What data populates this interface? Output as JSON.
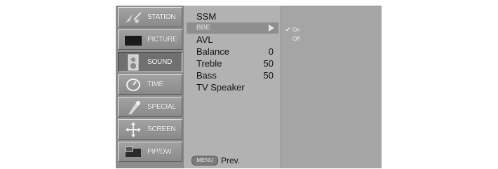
{
  "sidebar": {
    "items": [
      {
        "label": "STATION",
        "icon": "station-icon"
      },
      {
        "label": "PICTURE",
        "icon": "picture-icon"
      },
      {
        "label": "SOUND",
        "icon": "speaker-icon",
        "active": true
      },
      {
        "label": "TIME",
        "icon": "clock-icon"
      },
      {
        "label": "SPECIAL",
        "icon": "special-icon"
      },
      {
        "label": "SCREEN",
        "icon": "screen-arrows-icon"
      },
      {
        "label": "PIP/DW",
        "icon": "pip-icon"
      }
    ]
  },
  "menu": {
    "items": [
      {
        "label": "SSM",
        "value": ""
      },
      {
        "label": "BBE",
        "value": "",
        "selected": true
      },
      {
        "label": "AVL",
        "value": ""
      },
      {
        "label": "Balance",
        "value": "0"
      },
      {
        "label": "Treble",
        "value": "50"
      },
      {
        "label": "Bass",
        "value": "50"
      },
      {
        "label": "TV Speaker",
        "value": ""
      }
    ],
    "menu_button_label": "MENU",
    "prev_label": "Prev."
  },
  "submenu": {
    "options": [
      {
        "label": "On",
        "checked": true
      },
      {
        "label": "Off",
        "checked": false
      }
    ]
  },
  "colors": {
    "panel": "#a9a9a9",
    "sidebar": "#8d8d8d",
    "selected": "#8e8e8e"
  }
}
